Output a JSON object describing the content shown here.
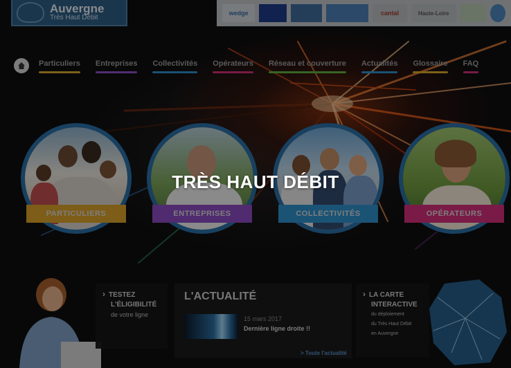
{
  "header": {
    "logo_title": "Auvergne",
    "logo_subtitle": "Très Haut Débit",
    "partners": [
      {
        "label": "wedge"
      },
      {
        "label": ""
      },
      {
        "label": ""
      },
      {
        "label": ""
      },
      {
        "label": "cantal"
      },
      {
        "label": "Haute-Loire"
      },
      {
        "label": ""
      },
      {
        "label": ""
      }
    ]
  },
  "nav": {
    "items": [
      {
        "label": "Particuliers",
        "color": "#d9a62a"
      },
      {
        "label": "Entreprises",
        "color": "#8c4fc3"
      },
      {
        "label": "Collectivités",
        "color": "#2e8ec9"
      },
      {
        "label": "Opérateurs",
        "color": "#d02f78"
      },
      {
        "label": "Réseau et couverture",
        "color": "#5fae3c"
      },
      {
        "label": "Actualités",
        "color": "#2e8ec9"
      },
      {
        "label": "Glossaire",
        "color": "#d9a62a"
      },
      {
        "label": "FAQ",
        "color": "#d02f78"
      }
    ]
  },
  "circles": [
    {
      "label": "PARTICULIERS",
      "color": "#d8a12a"
    },
    {
      "label": "ENTREPRISES",
      "color": "#8a4bbf"
    },
    {
      "label": "COLLECTIVITÉS",
      "color": "#2f8fca"
    },
    {
      "label": "OPÉRATEURS",
      "color": "#d2307a"
    }
  ],
  "overlay_title": "TRÈS HAUT DÉBIT",
  "panels": {
    "test": {
      "line1": "TESTEZ",
      "line2": "L'ÉLIGIBILITÉ",
      "line3": "de votre ligne"
    },
    "news": {
      "title": "L'ACTUALITÉ",
      "date": "15 mars 2017",
      "headline": "Dernière ligne droite !!",
      "all_link": "> Toute l'actualité"
    },
    "map": {
      "line1": "LA CARTE",
      "line2": "INTERACTIVE",
      "line3": "du déploiement",
      "line4": "du Très Haut Débit",
      "line5": "en Auvergne"
    }
  }
}
